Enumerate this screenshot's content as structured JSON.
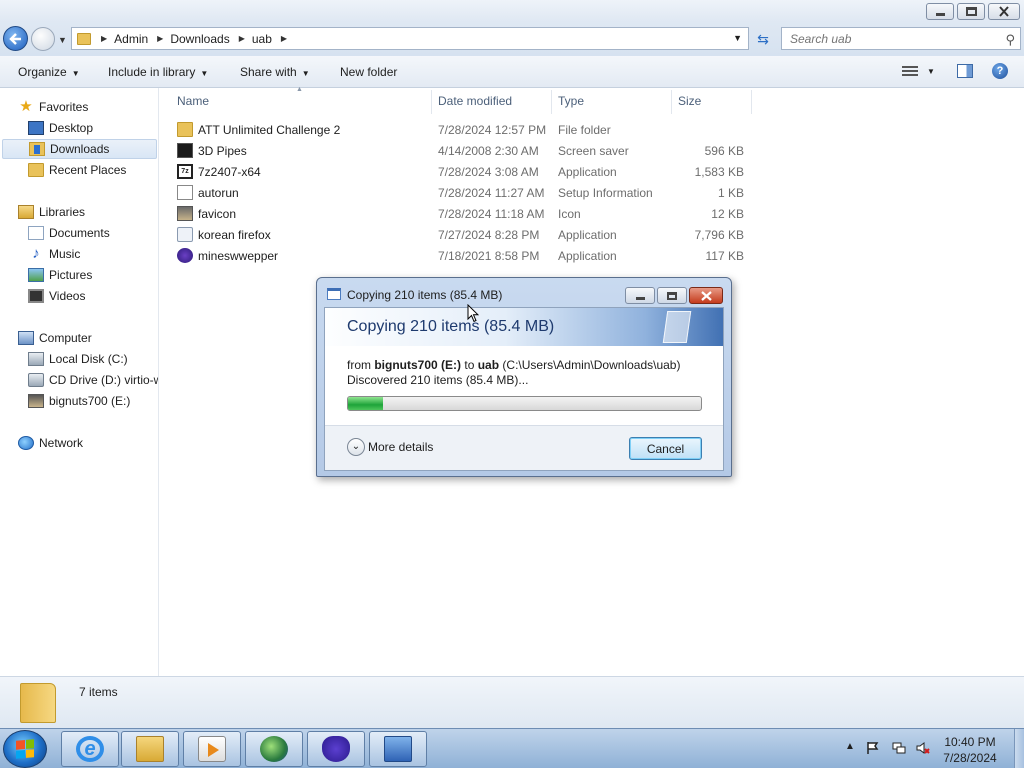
{
  "window": {
    "title_buttons": [
      "minimize",
      "maximize",
      "close"
    ]
  },
  "address_bar": {
    "breadcrumbs": [
      "Admin",
      "Downloads",
      "uab"
    ],
    "search_placeholder": "Search uab"
  },
  "toolbar": {
    "organize": "Organize",
    "include_in_library": "Include in library",
    "share_with": "Share with",
    "new_folder": "New folder"
  },
  "nav": {
    "favorites": "Favorites",
    "desktop": "Desktop",
    "downloads": "Downloads",
    "recent_places": "Recent Places",
    "libraries": "Libraries",
    "documents": "Documents",
    "music": "Music",
    "pictures": "Pictures",
    "videos": "Videos",
    "computer": "Computer",
    "local_disk": "Local Disk (C:)",
    "cd_drive": "CD Drive (D:) virtio-w",
    "usb": "bignuts700 (E:)",
    "network": "Network",
    "selected": "Downloads"
  },
  "columns": {
    "name": "Name",
    "date_modified": "Date modified",
    "type": "Type",
    "size": "Size"
  },
  "files": [
    {
      "name": "ATT Unlimited Challenge 2",
      "date": "7/28/2024 12:57 PM",
      "type": "File folder",
      "size": "",
      "icon": "folder-icon"
    },
    {
      "name": "3D Pipes",
      "date": "4/14/2008 2:30 AM",
      "type": "Screen saver",
      "size": "596 KB",
      "icon": "screensaver-icon"
    },
    {
      "name": "7z2407-x64",
      "date": "7/28/2024 3:08 AM",
      "type": "Application",
      "size": "1,583 KB",
      "icon": "7zip-icon"
    },
    {
      "name": "autorun",
      "date": "7/28/2024 11:27 AM",
      "type": "Setup Information",
      "size": "1 KB",
      "icon": "setup-info-icon"
    },
    {
      "name": "favicon",
      "date": "7/28/2024 11:18 AM",
      "type": "Icon",
      "size": "12 KB",
      "icon": "image-icon"
    },
    {
      "name": "korean firefox",
      "date": "7/27/2024 8:28 PM",
      "type": "Application",
      "size": "7,796 KB",
      "icon": "application-icon"
    },
    {
      "name": "mineswwepper",
      "date": "7/18/2021 8:58 PM",
      "type": "Application",
      "size": "117 KB",
      "icon": "minesweeper-icon"
    }
  ],
  "status": {
    "item_count": "7 items"
  },
  "dialog": {
    "title": "Copying 210 items (85.4 MB)",
    "heading": "Copying 210 items (85.4 MB)",
    "from_prefix": "from",
    "source": "bignuts700 (E:)",
    "to_word": "to",
    "dest": "uab",
    "dest_path": "(C:\\Users\\Admin\\Downloads\\uab)",
    "status": "Discovered 210 items (85.4 MB)...",
    "progress": 0.1,
    "more_details": "More details",
    "cancel": "Cancel"
  },
  "taskbar": {
    "apps": [
      "internet-explorer-icon",
      "windows-explorer-icon",
      "media-player-icon",
      "globe-app-icon",
      "blue-app-icon",
      "control-panel-icon"
    ],
    "time": "10:40 PM",
    "date": "7/28/2024"
  }
}
